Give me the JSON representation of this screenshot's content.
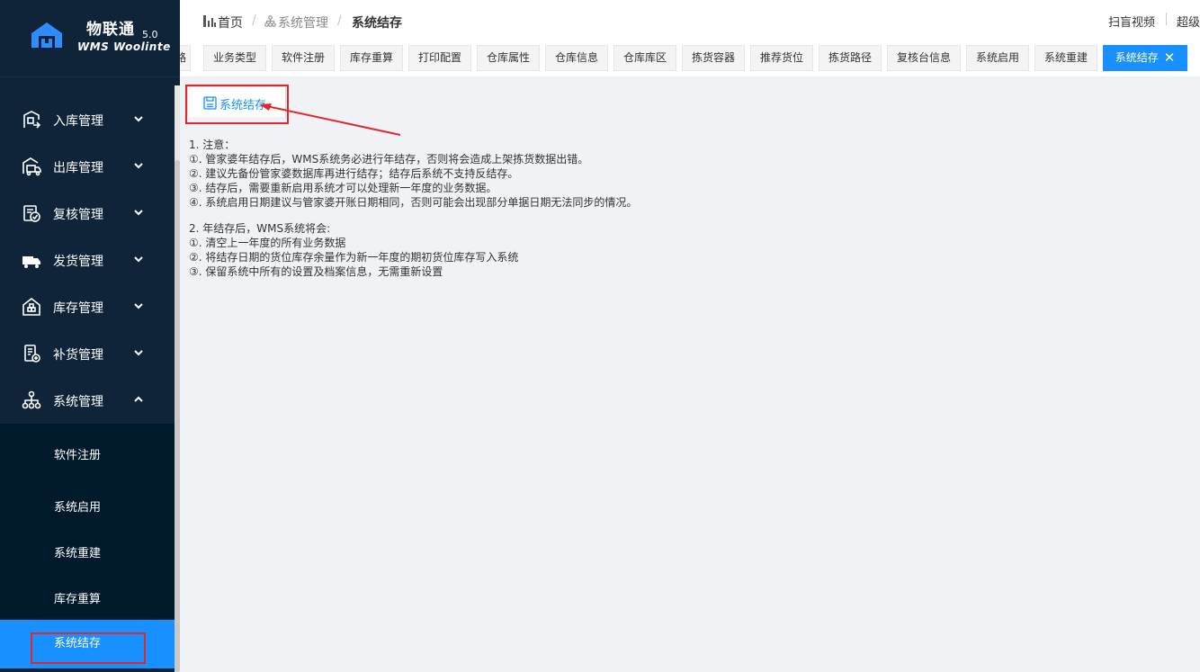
{
  "brand": {
    "title": "物联通",
    "version": "5.0",
    "subtitle": "WMS Woolinte",
    "logo_icon": "warehouse-house-icon"
  },
  "sidebar": {
    "menu": [
      {
        "label": "入库管理",
        "icon": "inbound-icon",
        "expanded": false
      },
      {
        "label": "出库管理",
        "icon": "outbound-truck-icon",
        "expanded": false
      },
      {
        "label": "复核管理",
        "icon": "review-check-icon",
        "expanded": false
      },
      {
        "label": "发货管理",
        "icon": "delivery-truck-icon",
        "expanded": false
      },
      {
        "label": "库存管理",
        "icon": "inventory-icon",
        "expanded": false
      },
      {
        "label": "补货管理",
        "icon": "replenish-icon",
        "expanded": false
      },
      {
        "label": "系统管理",
        "icon": "org-chart-icon",
        "expanded": true
      }
    ],
    "submenu": [
      {
        "label": "软件注册",
        "active": false
      },
      {
        "label": "系统启用",
        "active": false
      },
      {
        "label": "系统重建",
        "active": false
      },
      {
        "label": "库存重算",
        "active": false
      },
      {
        "label": "系统结存",
        "active": true
      }
    ]
  },
  "header": {
    "breadcrumb": {
      "home": "首页",
      "sep": "/",
      "parent": "系统管理",
      "current": "系统结存"
    },
    "video_link": "扫盲视频",
    "user": "超级管理员"
  },
  "tabs": [
    {
      "label": "路",
      "active": false
    },
    {
      "label": "业务类型",
      "active": false
    },
    {
      "label": "软件注册",
      "active": false
    },
    {
      "label": "库存重算",
      "active": false
    },
    {
      "label": "打印配置",
      "active": false
    },
    {
      "label": "仓库属性",
      "active": false
    },
    {
      "label": "仓库信息",
      "active": false
    },
    {
      "label": "仓库库区",
      "active": false
    },
    {
      "label": "拣货容器",
      "active": false
    },
    {
      "label": "推荐货位",
      "active": false
    },
    {
      "label": "拣货路径",
      "active": false
    },
    {
      "label": "复核台信息",
      "active": false
    },
    {
      "label": "系统启用",
      "active": false
    },
    {
      "label": "系统重建",
      "active": false
    },
    {
      "label": "系统结存",
      "active": true,
      "close": "✕"
    }
  ],
  "content": {
    "action_button": "系统结存",
    "notes_1": [
      "1. 注意：",
      "①. 管家婆年结存后，WMS系统务必进行年结存，否则将会造成上架拣货数据出错。",
      "②. 建议先备份管家婆数据库再进行结存；结存后系统不支持反结存。",
      "③. 结存后，需要重新启用系统才可以处理新一年度的业务数据。",
      "④. 系统启用日期建议与管家婆开账日期相同，否则可能会出现部分单据日期无法同步的情况。"
    ],
    "notes_2": [
      "2. 年结存后，WMS系统将会:",
      "①. 清空上一年度的所有业务数据",
      "②. 将结存日期的货位库存余量作为新一年度的期初货位库存写入系统",
      "③. 保留系统中所有的设置及档案信息，无需重新设置"
    ]
  },
  "colors": {
    "sidebar_bg": "#0f2438",
    "submenu_bg": "#001a2c",
    "accent": "#1890ff",
    "annotation": "#e0282e"
  }
}
